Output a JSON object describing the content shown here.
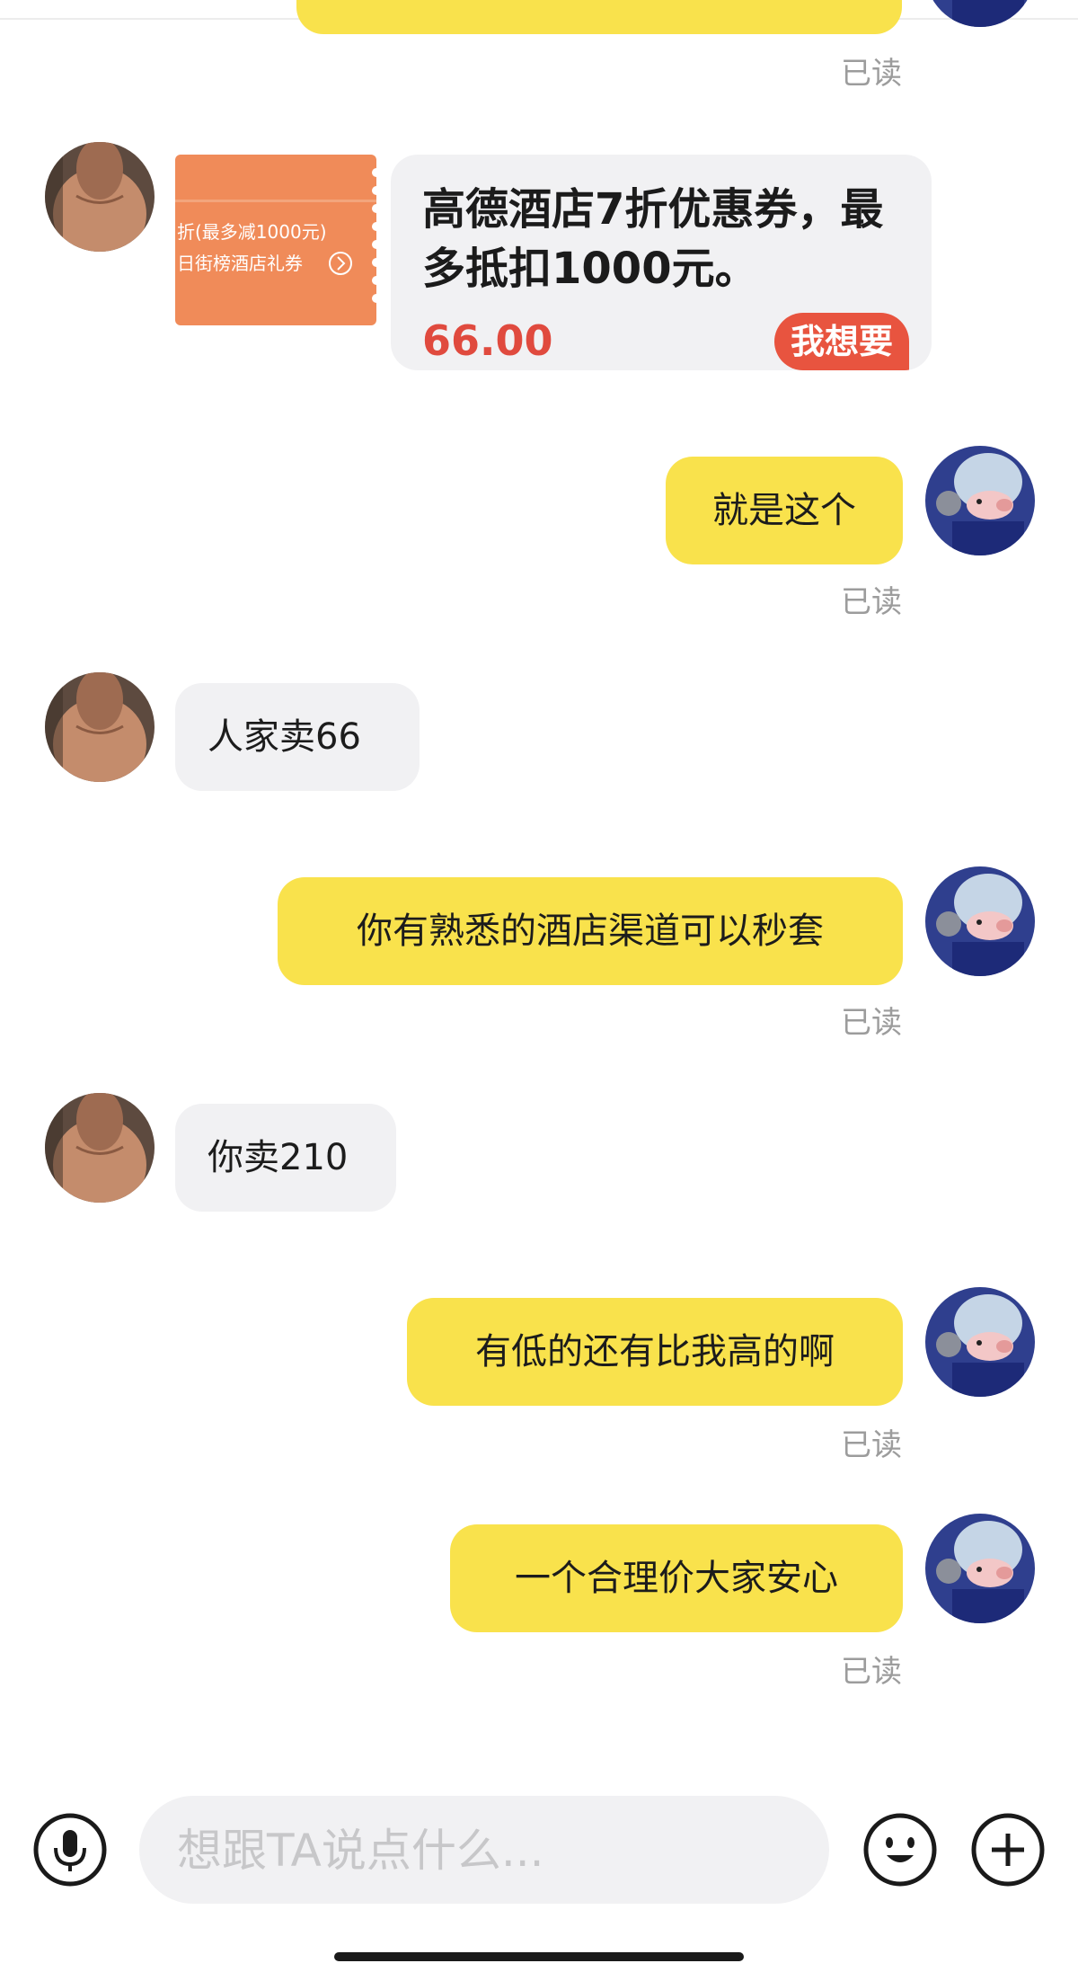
{
  "messages": {
    "read_label": "已读",
    "m1": "就是这个",
    "m2": "人家卖66",
    "m3": "你有熟悉的酒店渠道可以秒套",
    "m4": "你卖210",
    "m5": "有低的还有比我高的啊",
    "m6": "一个合理价大家安心"
  },
  "product_card": {
    "coupon_line1": "折(最多减1000元)",
    "coupon_line2": "日街榜酒店礼券",
    "title": "高德酒店7折优惠券，最多抵扣1000元。",
    "price": "66.00",
    "want_button": "我想要"
  },
  "input_bar": {
    "placeholder": "想跟TA说点什么..."
  },
  "icons": [
    "microphone-icon",
    "emoji-icon",
    "plus-icon"
  ],
  "colors": {
    "my_bubble": "#f9e24c",
    "other_bubble": "#f1f1f3",
    "price": "#e04a3e",
    "want_button": "#e8543f",
    "coupon": "#f08b59"
  }
}
